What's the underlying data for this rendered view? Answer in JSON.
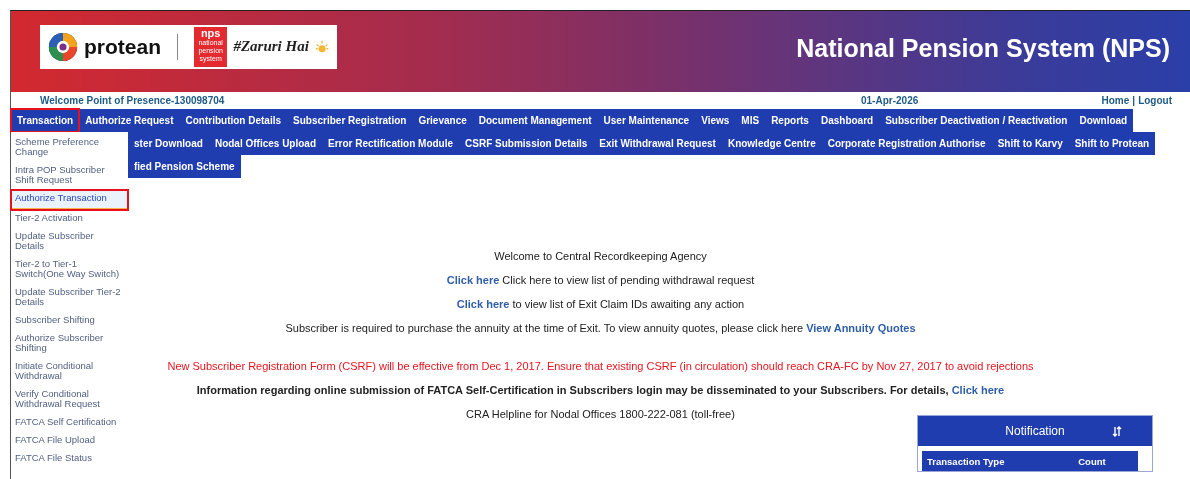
{
  "header": {
    "logo": {
      "brand": "protean",
      "nps_mark": "nps",
      "nps_caption": "national pension system",
      "tagline": "#Zaruri Hai"
    },
    "title": "National Pension System (NPS)"
  },
  "welcome_bar": {
    "welcome": "Welcome Point of Presence-130098704",
    "date": "01-Apr-2026",
    "links": [
      "Home",
      "Logout"
    ],
    "separator": "|"
  },
  "menu": {
    "items": [
      {
        "label": "Transaction",
        "annotated": true
      },
      {
        "label": "Authorize Request",
        "annotated": false
      },
      {
        "label": "Contribution Details",
        "annotated": false
      },
      {
        "label": "Subscriber Registration",
        "annotated": false
      },
      {
        "label": "Grievance",
        "annotated": false
      },
      {
        "label": "Document Management",
        "annotated": false
      },
      {
        "label": "User Maintenance",
        "annotated": false
      },
      {
        "label": "Views",
        "annotated": false
      },
      {
        "label": "MIS",
        "annotated": false
      },
      {
        "label": "Reports",
        "annotated": false
      },
      {
        "label": "Dashboard",
        "annotated": false
      },
      {
        "label": "Subscriber Deactivation / Reactivation",
        "annotated": false
      },
      {
        "label": "Download",
        "annotated": false
      },
      {
        "label": "ster Download",
        "annotated": false,
        "starts_line": true
      },
      {
        "label": "Nodal Offices Upload",
        "annotated": false
      },
      {
        "label": "Error Rectification Module",
        "annotated": false
      },
      {
        "label": "CSRF Submission Details",
        "annotated": false
      },
      {
        "label": "Exit Withdrawal Request",
        "annotated": false
      },
      {
        "label": "Knowledge Centre",
        "annotated": false
      },
      {
        "label": "Corporate Registration Authorise",
        "annotated": false
      },
      {
        "label": "Shift to Karvy",
        "annotated": false
      },
      {
        "label": "Shift to Protean",
        "annotated": false
      },
      {
        "label": "fied Pension Scheme",
        "annotated": false,
        "starts_line": true
      }
    ]
  },
  "dropdown": {
    "items": [
      {
        "label": "Scheme Preference Change",
        "selected": false,
        "annotated": false
      },
      {
        "label": "Intra POP Subscriber Shift Request",
        "selected": false,
        "annotated": false
      },
      {
        "label": "Authorize Transaction",
        "selected": true,
        "annotated": true
      },
      {
        "label": "Tier-2 Activation",
        "selected": false,
        "annotated": false
      },
      {
        "label": "Update Subscriber Details",
        "selected": false,
        "annotated": false
      },
      {
        "label": "Tier-2 to Tier-1 Switch(One Way Switch)",
        "selected": false,
        "annotated": false
      },
      {
        "label": "Update Subscriber Tier-2 Details",
        "selected": false,
        "annotated": false
      },
      {
        "label": "Subscriber Shifting",
        "selected": false,
        "annotated": false
      },
      {
        "label": "Authorize Subscriber Shifting",
        "selected": false,
        "annotated": false
      },
      {
        "label": "Initiate Conditional Withdrawal",
        "selected": false,
        "annotated": false
      },
      {
        "label": "Verify Conditional Withdrawal Request",
        "selected": false,
        "annotated": false
      },
      {
        "label": "FATCA Self Certification",
        "selected": false,
        "annotated": false
      },
      {
        "label": "FATCA File Upload",
        "selected": false,
        "annotated": false
      },
      {
        "label": "FATCA File Status",
        "selected": false,
        "annotated": false
      }
    ]
  },
  "content": {
    "lines": [
      {
        "kind": "plain",
        "segments": [
          {
            "kind": "text",
            "text": "Welcome to Central Recordkeeping Agency"
          }
        ]
      },
      {
        "kind": "plain",
        "segments": [
          {
            "kind": "link",
            "text": "Click here"
          },
          {
            "kind": "text",
            "text": " Click here to view list of pending withdrawal request"
          }
        ]
      },
      {
        "kind": "plain",
        "segments": [
          {
            "kind": "link",
            "text": "Click here"
          },
          {
            "kind": "text",
            "text": " to view list of Exit Claim IDs awaiting any action"
          }
        ]
      },
      {
        "kind": "plain",
        "segments": [
          {
            "kind": "text",
            "text": "Subscriber is required to purchase the annuity at the time of Exit. To view annuity quotes, please click here "
          },
          {
            "kind": "link",
            "text": "View Annuity Quotes"
          }
        ]
      },
      {
        "kind": "alert",
        "segments": [
          {
            "kind": "text",
            "text": "New Subscriber Registration Form (CSRF) will be effective from Dec 1, 2017. Ensure that existing CSRF (in circulation) should reach CRA-FC by Nov 27, 2017 to avoid rejections"
          }
        ]
      },
      {
        "kind": "bold",
        "segments": [
          {
            "kind": "text",
            "text": "Information regarding online submission of FATCA Self-Certification in Subscribers login may be disseminated to your Subscribers. For details, "
          },
          {
            "kind": "link",
            "text": "Click here"
          }
        ]
      },
      {
        "kind": "plain",
        "segments": [
          {
            "kind": "text",
            "text": "CRA Helpline for Nodal Offices 1800-222-081 (toll-free)"
          }
        ]
      }
    ]
  },
  "notification": {
    "title": "Notification",
    "table": {
      "columns": [
        "Transaction Type",
        "Count"
      ]
    }
  }
}
